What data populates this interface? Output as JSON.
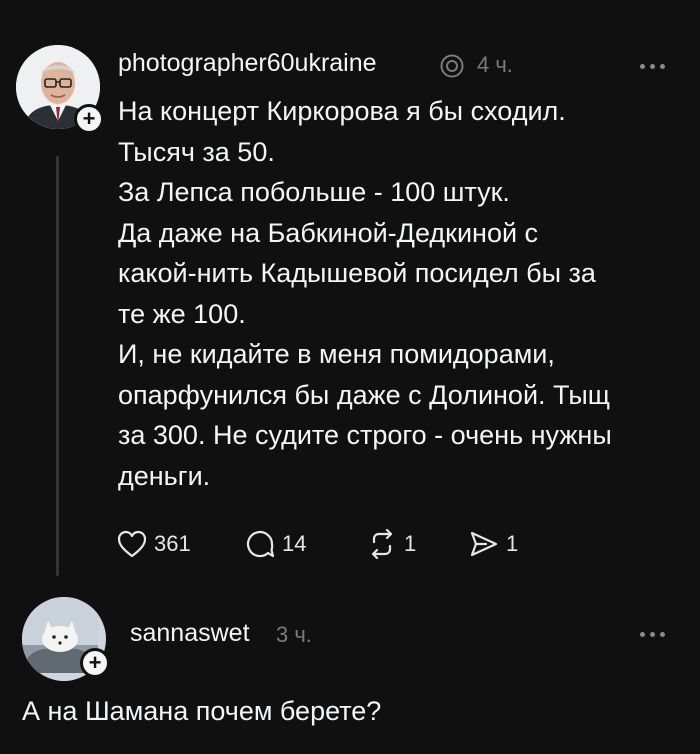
{
  "post": {
    "username": "photographer60ukraine",
    "time": "4 ч.",
    "lines": [
      "На концерт Киркорова я бы сходил.",
      "Тысяч за 50.",
      "За Лепса побольше - 100 штук.",
      "Да даже на Бабкиной-Дедкиной с",
      "какой-нить Кадышевой посидел бы за",
      "те же 100.",
      "И, не кидайте в меня помидорами,",
      "опарфунился бы даже с Долиной. Тыщ",
      "за 300. Не судите строго - очень нужны",
      "деньги."
    ],
    "likes": "361",
    "replies": "14",
    "reposts": "1",
    "shares": "1"
  },
  "reply": {
    "username": "sannaswet",
    "time": "3 ч.",
    "text": "А на Шамана почем берете?"
  },
  "colors": {
    "background": "#101010",
    "text": "#f3f5f7",
    "secondary": "#7a7a7a"
  }
}
